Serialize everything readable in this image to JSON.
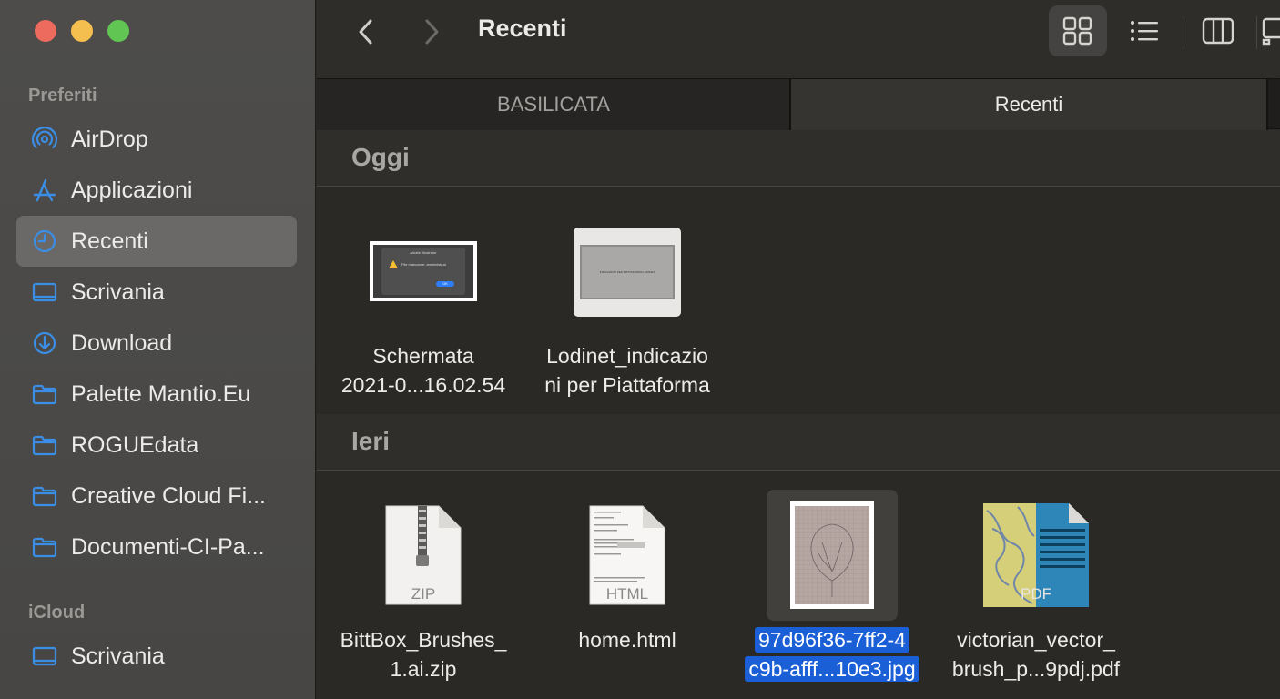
{
  "window": {
    "title": "Recenti"
  },
  "sidebar": {
    "favorites_title": "Preferiti",
    "favorites": [
      {
        "label": "AirDrop",
        "icon": "airdrop-icon"
      },
      {
        "label": "Applicazioni",
        "icon": "applications-icon"
      },
      {
        "label": "Recenti",
        "icon": "clock-icon",
        "active": true
      },
      {
        "label": "Scrivania",
        "icon": "desktop-icon"
      },
      {
        "label": "Download",
        "icon": "download-icon"
      },
      {
        "label": "Palette Mantio.Eu",
        "icon": "folder-icon"
      },
      {
        "label": "ROGUEdata",
        "icon": "folder-icon"
      },
      {
        "label": "Creative Cloud Fi...",
        "icon": "folder-icon"
      },
      {
        "label": "Documenti-CI-Pa...",
        "icon": "folder-icon"
      }
    ],
    "icloud_title": "iCloud",
    "icloud": [
      {
        "label": "Scrivania",
        "icon": "desktop-icon"
      }
    ]
  },
  "tabs": [
    {
      "label": "BASILICATA",
      "active": false
    },
    {
      "label": "Recenti",
      "active": true
    }
  ],
  "groups": [
    {
      "title": "Oggi",
      "files": [
        {
          "name_line1": "Schermata",
          "name_line2": "2021-0...16.02.54",
          "kind": "screenshot",
          "dialog_title": "Adobe Illustrator",
          "dialog_text": "File mancante: amministr.ai",
          "dialog_button": "OK"
        },
        {
          "name_line1": "Lodinet_indicazio",
          "name_line2": "ni per Piattaforma",
          "kind": "document",
          "doc_text": "INDICAZIONI PER PIATTAFORMA LODINET"
        }
      ]
    },
    {
      "title": "Ieri",
      "files": [
        {
          "name_line1": "BittBox_Brushes_",
          "name_line2": "1.ai.zip",
          "kind": "zip",
          "badge": "ZIP"
        },
        {
          "name_line1": "home.html",
          "name_line2": "",
          "kind": "html",
          "badge": "HTML"
        },
        {
          "name_line1": "97d96f36-7ff2-4",
          "name_line2": "c9b-afff...10e3.jpg",
          "kind": "jpg",
          "selected": true
        },
        {
          "name_line1": "victorian_vector_",
          "name_line2": "brush_p...9pdj.pdf",
          "kind": "pdf",
          "badge": "PDF"
        }
      ]
    }
  ],
  "colors": {
    "selection": "#1a5fd6",
    "close": "#ed6a5e",
    "minimize": "#f5bf4f",
    "maximize": "#61c554",
    "sidebar_icon": "#3a8ee6"
  }
}
